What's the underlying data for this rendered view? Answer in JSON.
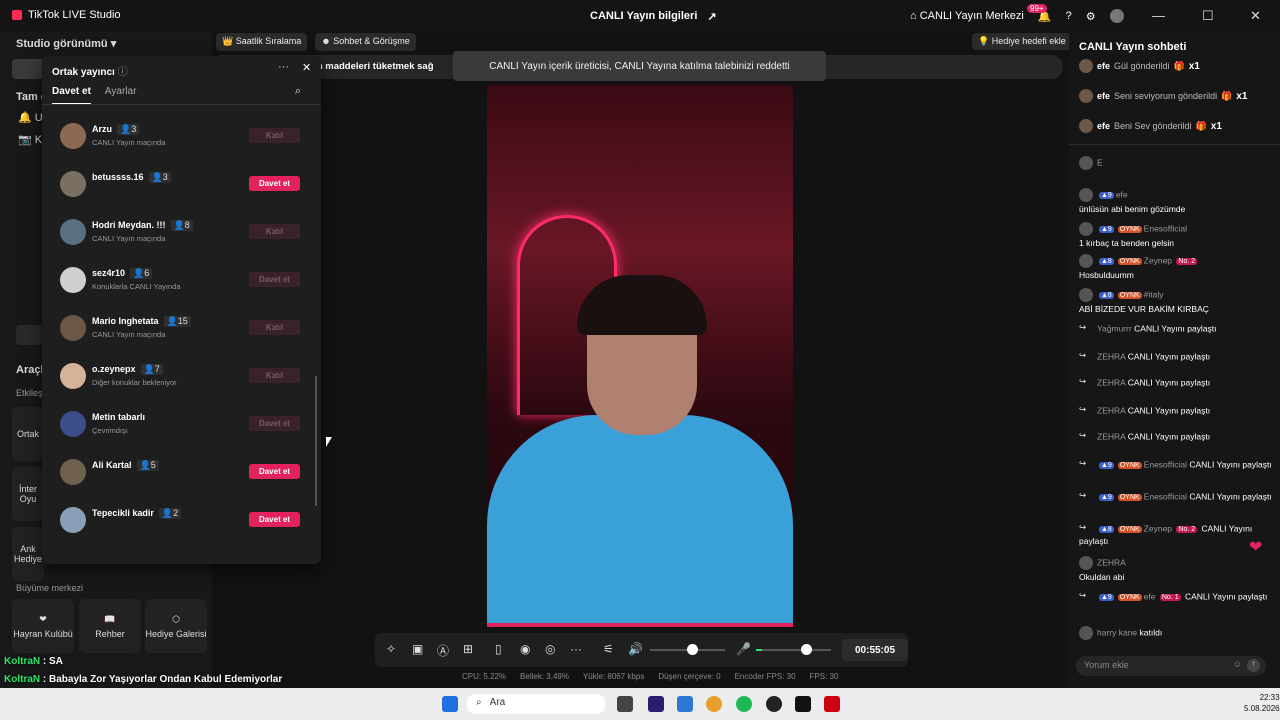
{
  "app": {
    "title": "TikTok LIVE Studio",
    "center_title": "CANLI Yayın bilgileri",
    "live_center": "CANLI Yayın Merkezi",
    "notif_badge": "99+"
  },
  "left": {
    "view_label": "Studio görünümü",
    "tam": "Tam e",
    "u": "U",
    "k": "K",
    "tools": "Araçl",
    "etkilesim": "Etkileş",
    "ortak": "Ortak",
    "inter": "İnter Oyu",
    "ank": "Ank Hediye",
    "growth": "Büyüme merkezi",
    "growth_items": [
      "Hayran Kulübü",
      "Rehber",
      "Hediye Galerisi"
    ]
  },
  "chips": [
    "Saatlik Sıralama",
    "Sohbet & Görüşme"
  ],
  "goal_button": "Hediye hedefi ekle",
  "message_bar": "er alan maddeleri tüketmek sağ",
  "toast": "CANLI Yayın içerik üreticisi, CANLI Yayına katılma talebinizi reddetti",
  "popup": {
    "title": "Ortak yayıncı",
    "tabs": [
      "Davet et",
      "Ayarlar"
    ],
    "rows": [
      {
        "name": "Arzu",
        "count": "3",
        "status": "CANLI Yayın maçında",
        "action": "Katıl",
        "enabled": false
      },
      {
        "name": "betussss.16",
        "count": "3",
        "status": "",
        "action": "Davet et",
        "enabled": true
      },
      {
        "name": "Hodri Meydan. !!!",
        "count": "8",
        "status": "CANLI Yayın maçında",
        "action": "Katıl",
        "enabled": false
      },
      {
        "name": "sez4r10",
        "count": "6",
        "status": "Konuklarla CANLI Yayında",
        "action": "Davet et",
        "enabled": false
      },
      {
        "name": "Mario Inghetata",
        "count": "15",
        "status": "CANLI Yayın maçında",
        "action": "Katıl",
        "enabled": false
      },
      {
        "name": "o.zeynepx",
        "count": "7",
        "status": "Diğer konuklar bekleniyor",
        "action": "Katıl",
        "enabled": false
      },
      {
        "name": "Metin tabarlı",
        "count": "",
        "status": "Çevrimdışı",
        "action": "Davet et",
        "enabled": false
      },
      {
        "name": "Ali Kartal",
        "count": "5",
        "status": "",
        "action": "Davet et",
        "enabled": true
      },
      {
        "name": "Tepecikli kadir",
        "count": "2",
        "status": "",
        "action": "Davet et",
        "enabled": true
      }
    ]
  },
  "timer": "00:55:05",
  "stats": [
    "CPU: 5.22%",
    "Bellek: 3.49%",
    "Yükle: 8067 kbps",
    "Düşen çerçeve: 0",
    "Encoder FPS: 30",
    "FPS: 30"
  ],
  "chat": {
    "title": "CANLI Yayın sohbeti",
    "gifts": [
      {
        "user": "efe",
        "text": "Gül gönderildi",
        "mult": "x1"
      },
      {
        "user": "efe",
        "text": "Seni seviyorum gönderildi",
        "mult": "x1"
      },
      {
        "user": "efe",
        "text": "Beni Sev gönderildi",
        "mult": "x1"
      }
    ],
    "messages": [
      {
        "name": "E",
        "text": ""
      },
      {
        "name": "efe",
        "level": "9",
        "text": "ünlüsün abi benim gözümde"
      },
      {
        "name": "Enesofficial",
        "level": "9",
        "tag": "OYNK",
        "text": "1 kırbaç ta benden gelsin"
      },
      {
        "name": "Zeynep",
        "level": "8",
        "tag": "OYNK",
        "rank": "No. 2",
        "text": "Hosbulduumm"
      },
      {
        "name": "#italy",
        "level": "8",
        "tag": "OYNK",
        "text": "ABİ BİZEDE VUR BAKİM KIRBAÇ"
      },
      {
        "name": "Yağmurrr",
        "text": "CANLI Yayını paylaştı"
      },
      {
        "name": "ZEHRA",
        "text": "CANLI Yayını paylaştı"
      },
      {
        "name": "ZEHRA",
        "text": "CANLI Yayını paylaştı"
      },
      {
        "name": "ZEHRA",
        "text": "CANLI Yayını paylaştı"
      },
      {
        "name": "ZEHRA",
        "text": "CANLI Yayını paylaştı"
      },
      {
        "name": "Enesofficial",
        "level": "9",
        "tag": "OYNK",
        "text": "CANLI Yayını paylaştı"
      },
      {
        "name": "Enesofficial",
        "level": "9",
        "tag": "OYNK",
        "text": "CANLI Yayını paylaştı"
      },
      {
        "name": "Zeynep",
        "level": "8",
        "tag": "OYNK",
        "rank": "No. 2",
        "text": "CANLI Yayını paylaştı"
      },
      {
        "name": "ZEHRA",
        "text": "Okuldan abi"
      },
      {
        "name": "efe",
        "level": "9",
        "tag": "OYNK",
        "rank": "No. 1",
        "text": "CANLI Yayını paylaştı"
      },
      {
        "name": "harry kane",
        "text": "katıldı"
      }
    ],
    "input_placeholder": "Yorum ekle"
  },
  "overlay": {
    "line1_name": "KoltraN",
    "line1_text": ": SA",
    "line2_name": "KoltraN",
    "line2_text": ": Babayla Zor Yaşıyorlar Ondan Kabul Edemiyorlar"
  },
  "taskbar": {
    "search": "Ara",
    "time": "22:33",
    "date": "5.08.2026"
  }
}
